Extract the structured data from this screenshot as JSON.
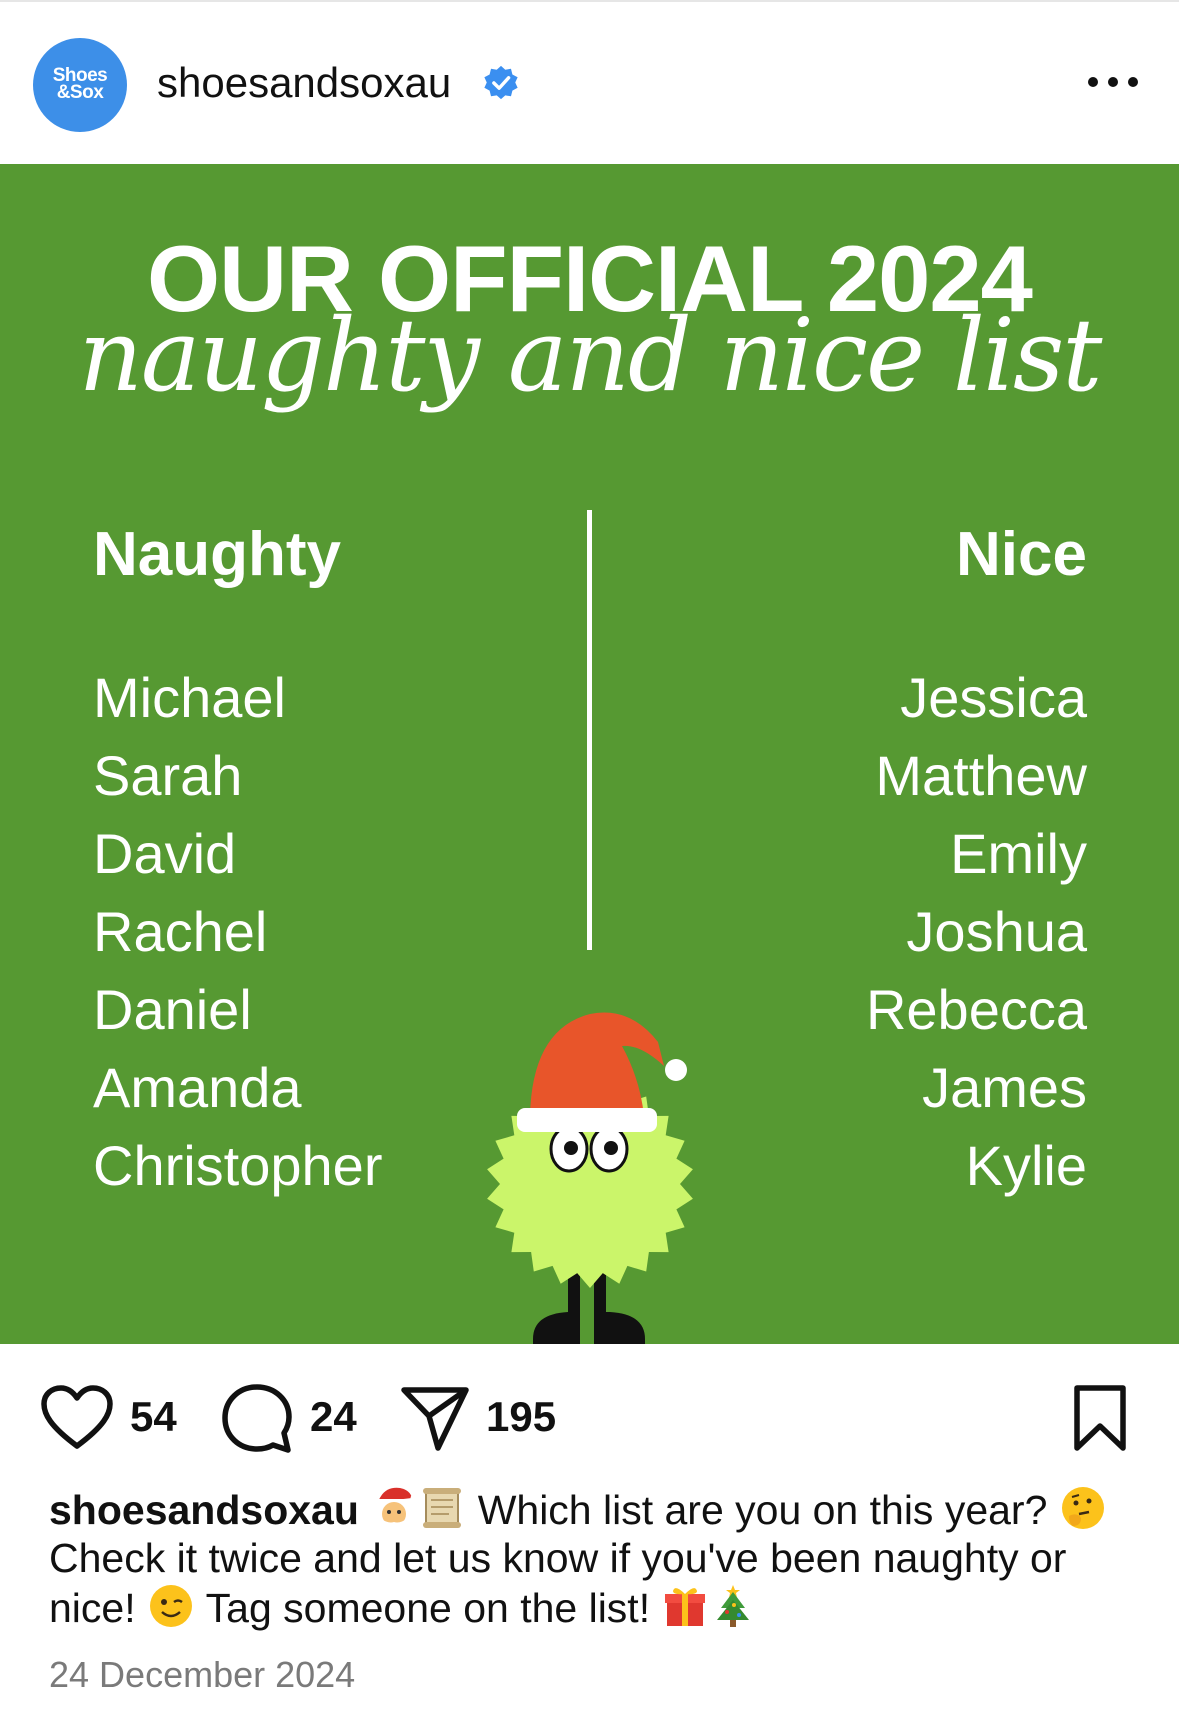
{
  "header": {
    "avatar_line1": "Shoes",
    "avatar_line2": "&Sox",
    "username": "shoesandsoxau",
    "verified_icon": "verified-badge-icon",
    "more_icon": "more-options-icon"
  },
  "post_image": {
    "title_line1": "OUR OFFICIAL 2024",
    "title_line2": "naughty and nice list",
    "naughty": {
      "heading": "Naughty",
      "names": [
        "Michael",
        "Sarah",
        "David",
        "Rachel",
        "Daniel",
        "Amanda",
        "Christopher"
      ]
    },
    "nice": {
      "heading": "Nice",
      "names": [
        "Jessica",
        "Matthew",
        "Emily",
        "Joshua",
        "Rebecca",
        "James",
        "Kylie"
      ]
    },
    "colors": {
      "background": "#569932",
      "text": "#ffffff",
      "mascot": "#cbf56a",
      "hat": "#e8552a"
    }
  },
  "actions": {
    "likes": "54",
    "comments": "24",
    "shares": "195",
    "icons": [
      "heart-icon",
      "comment-icon",
      "share-icon",
      "bookmark-icon"
    ]
  },
  "caption": {
    "username": "shoesandsoxau",
    "part1": " Which list are you on this year? ",
    "part2": " Check it twice and let us know if you've been naughty or nice! ",
    "part3": " Tag someone on the list! ",
    "emojis": [
      "santa-emoji",
      "scroll-emoji",
      "thinking-face-emoji",
      "winking-face-emoji",
      "gift-emoji",
      "christmas-tree-emoji"
    ]
  },
  "date": "24 December 2024"
}
